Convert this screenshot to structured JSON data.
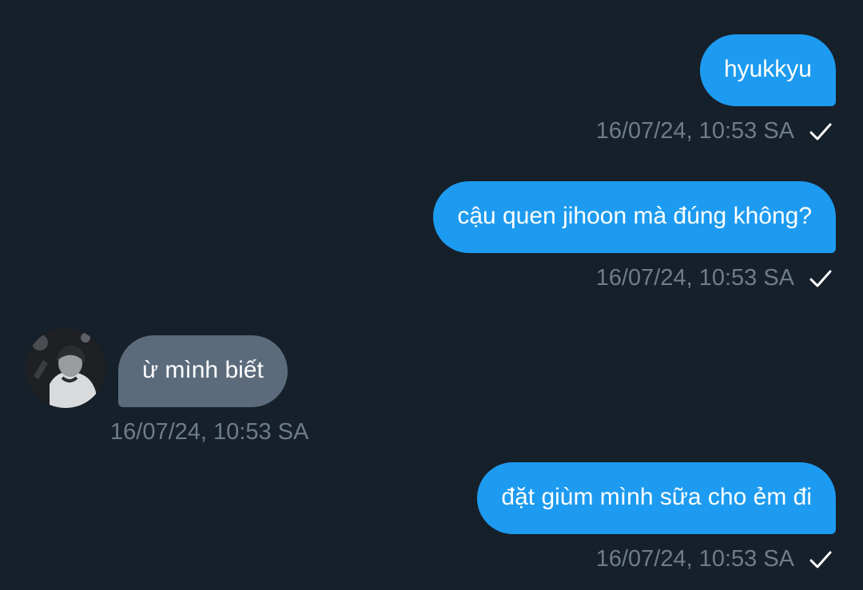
{
  "messages": [
    {
      "direction": "outgoing",
      "text": "hyukkyu",
      "time": "16/07/24, 10:53 SA",
      "status_icon": "check-icon"
    },
    {
      "direction": "outgoing",
      "text": "cậu quen jihoon mà đúng không?",
      "time": "16/07/24, 10:53 SA",
      "status_icon": "check-icon"
    },
    {
      "direction": "incoming",
      "text": "ừ mình biết",
      "time": "16/07/24, 10:53 SA"
    },
    {
      "direction": "outgoing",
      "text": "đặt giùm mình sữa cho ẻm đi",
      "time": "16/07/24, 10:53 SA",
      "status_icon": "check-icon"
    }
  ],
  "colors": {
    "background": "#16202b",
    "outgoing_bubble": "#1d9bf0",
    "incoming_bubble": "#5b6b7c",
    "timestamp": "#6f7c89"
  }
}
